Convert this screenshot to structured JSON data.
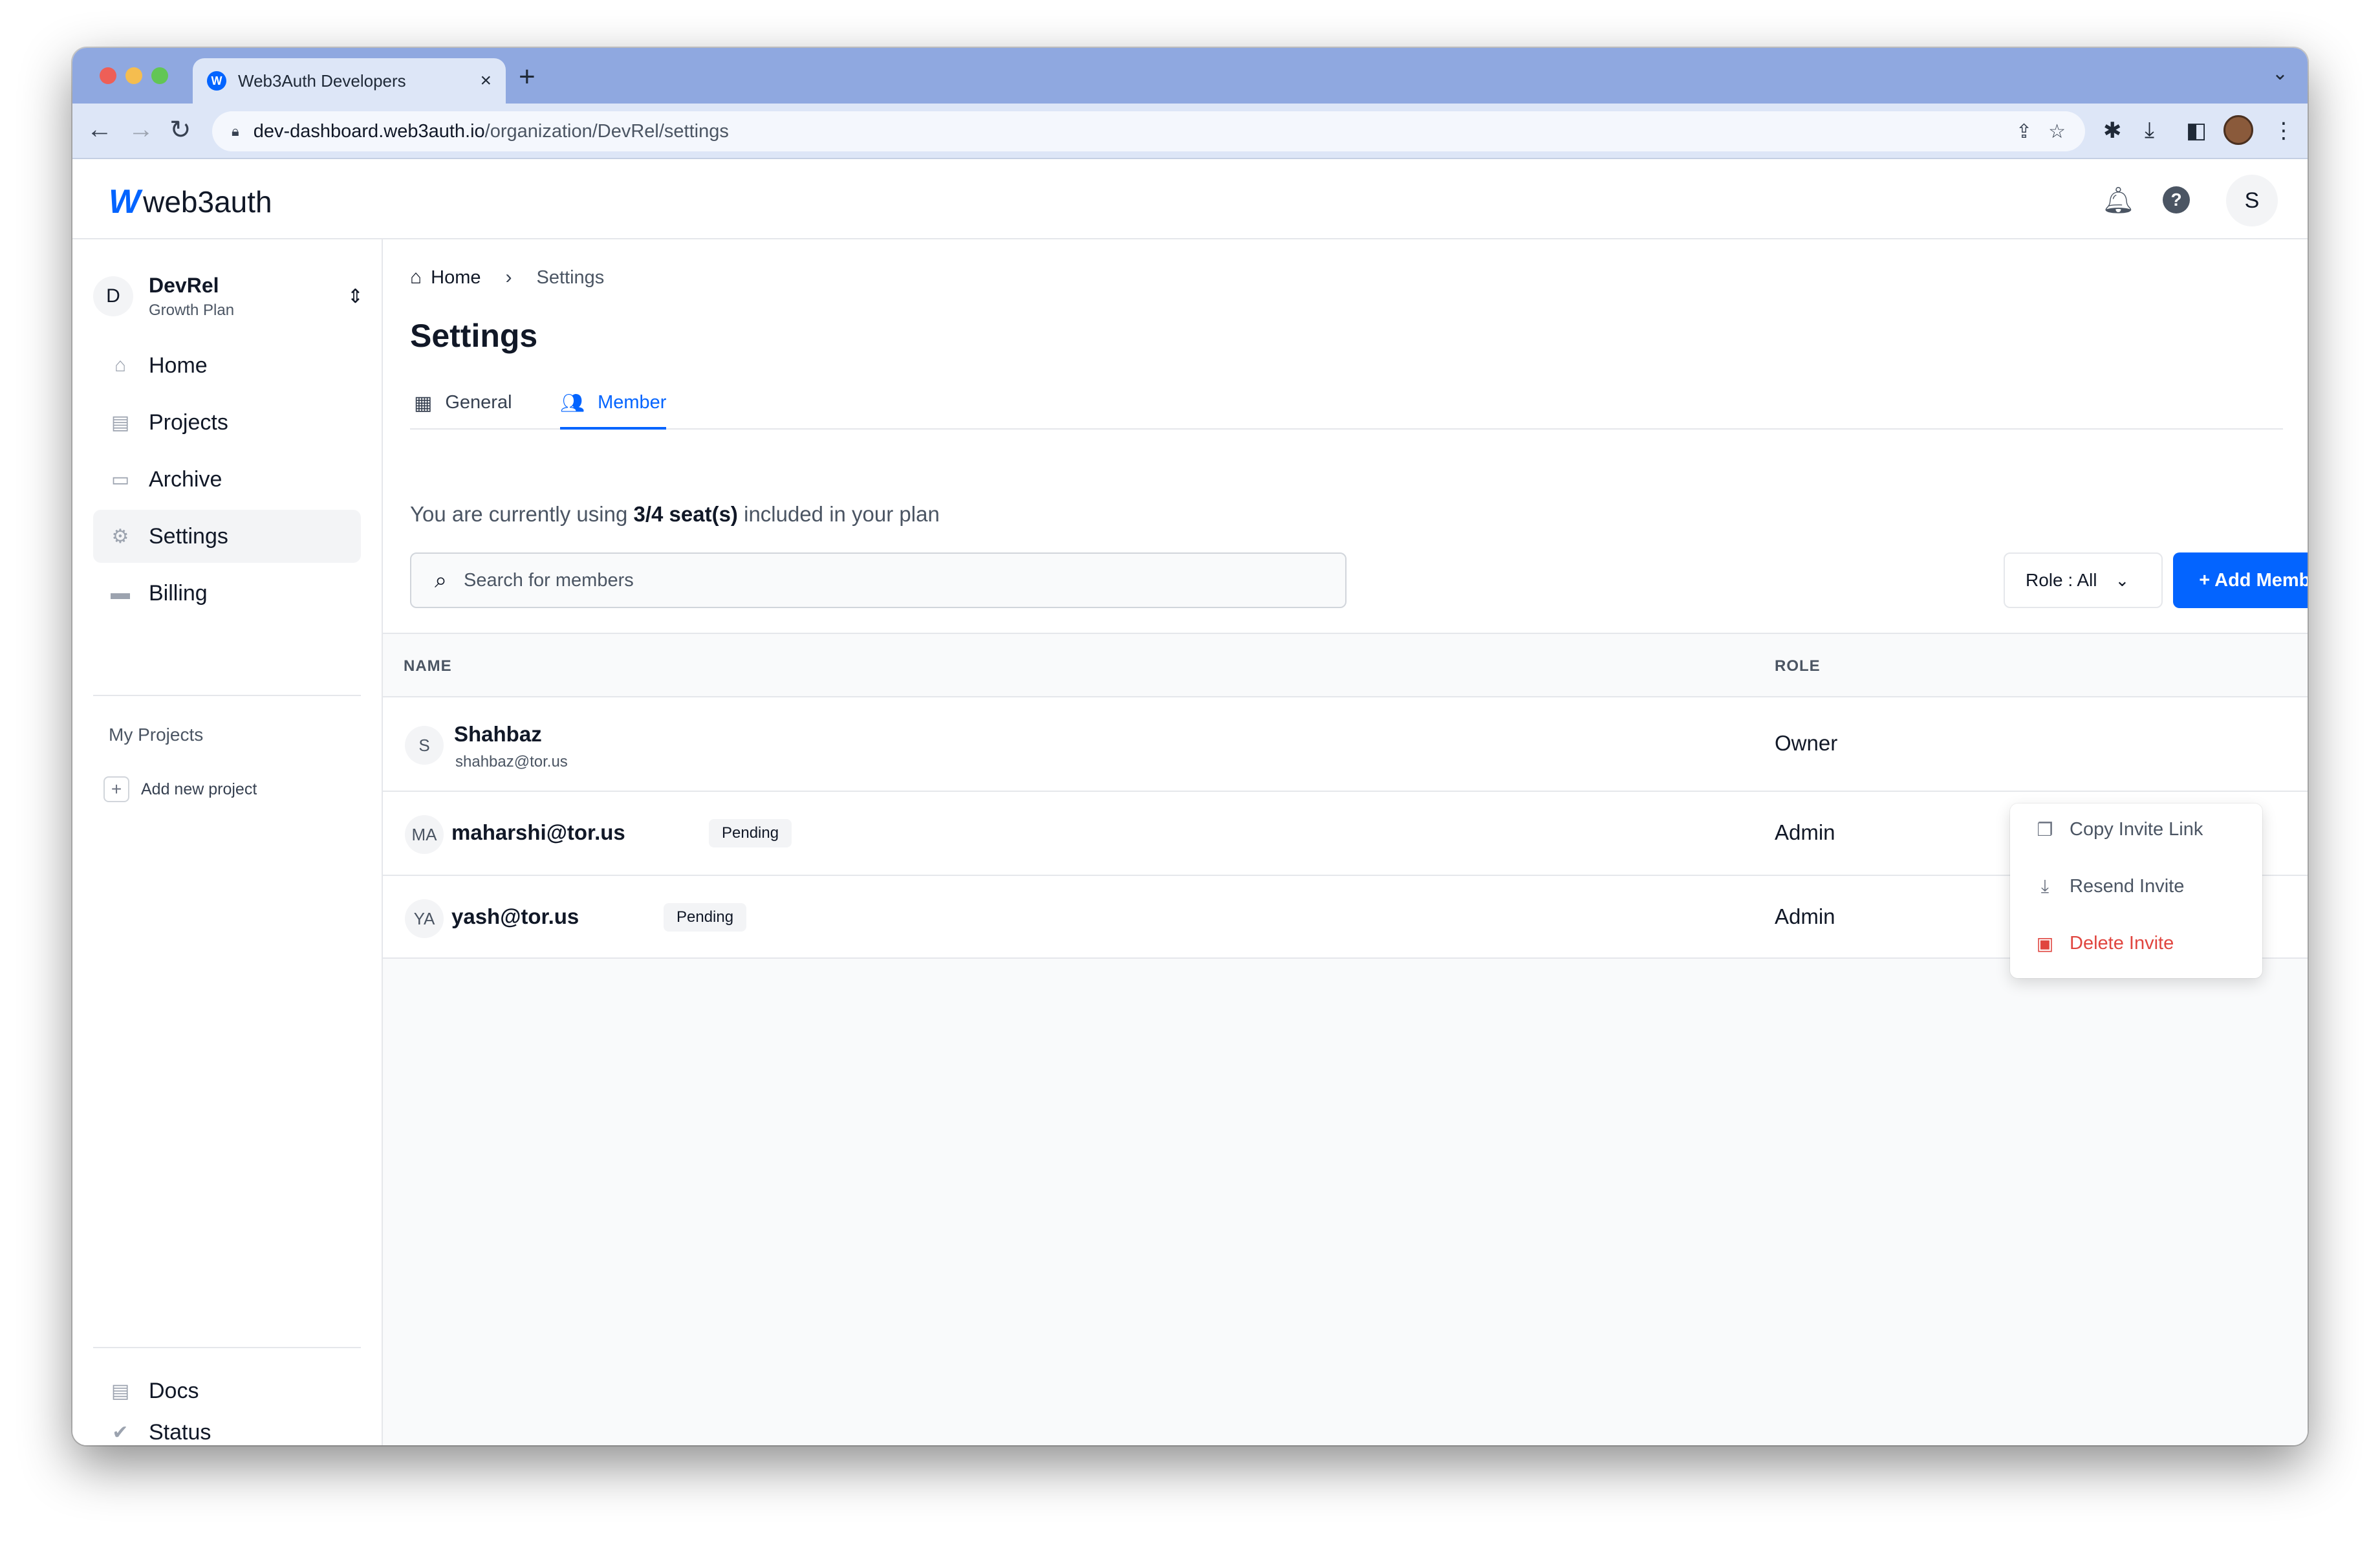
{
  "browser": {
    "tab_title": "Web3Auth Developers",
    "tab_favicon": "W",
    "url_host": "dev-dashboard.web3auth.io",
    "url_path": "/organization/DevRel/settings"
  },
  "header": {
    "logo_mark": "W",
    "logo_text": "web3auth",
    "avatar_initial": "S"
  },
  "sidebar": {
    "org_initial": "D",
    "org_name": "DevRel",
    "org_plan": "Growth Plan",
    "nav": [
      {
        "label": "Home",
        "icon": "home-icon"
      },
      {
        "label": "Projects",
        "icon": "projects-icon"
      },
      {
        "label": "Archive",
        "icon": "archive-icon"
      },
      {
        "label": "Settings",
        "icon": "gear-icon",
        "active": true
      },
      {
        "label": "Billing",
        "icon": "card-icon"
      }
    ],
    "my_projects_label": "My Projects",
    "add_project_label": "Add new project",
    "footer": [
      {
        "label": "Docs",
        "icon": "doc-icon"
      },
      {
        "label": "Status",
        "icon": "check-circle-icon"
      }
    ]
  },
  "main": {
    "breadcrumb": {
      "home": "Home",
      "current": "Settings"
    },
    "title": "Settings",
    "tabs": [
      {
        "label": "General",
        "icon": "building-icon"
      },
      {
        "label": "Member",
        "icon": "users-icon",
        "active": true
      }
    ],
    "seats": {
      "prefix": "You are currently using ",
      "count": "3/4 seat(s)",
      "suffix": " included in your plan"
    },
    "search_placeholder": "Search for members",
    "role_filter": "Role : All",
    "add_member": "+ Add Member",
    "table": {
      "headers": {
        "name": "NAME",
        "role": "ROLE"
      },
      "rows": [
        {
          "initials": "S",
          "name": "Shahbaz",
          "email": "shahbaz@tor.us",
          "role": "Owner"
        },
        {
          "initials": "MA",
          "name": "maharshi@tor.us",
          "badge": "Pending",
          "role": "Admin"
        },
        {
          "initials": "YA",
          "name": "yash@tor.us",
          "badge": "Pending",
          "role": "Admin"
        }
      ]
    },
    "row_menu": {
      "items": [
        {
          "label": "Copy Invite Link",
          "icon": "copy-icon"
        },
        {
          "label": "Resend Invite",
          "icon": "resend-icon"
        },
        {
          "label": "Delete Invite",
          "icon": "trash-icon",
          "color": "#e0453f"
        }
      ]
    }
  },
  "colors": {
    "accent": "#0364ff",
    "danger": "#e0453f"
  }
}
